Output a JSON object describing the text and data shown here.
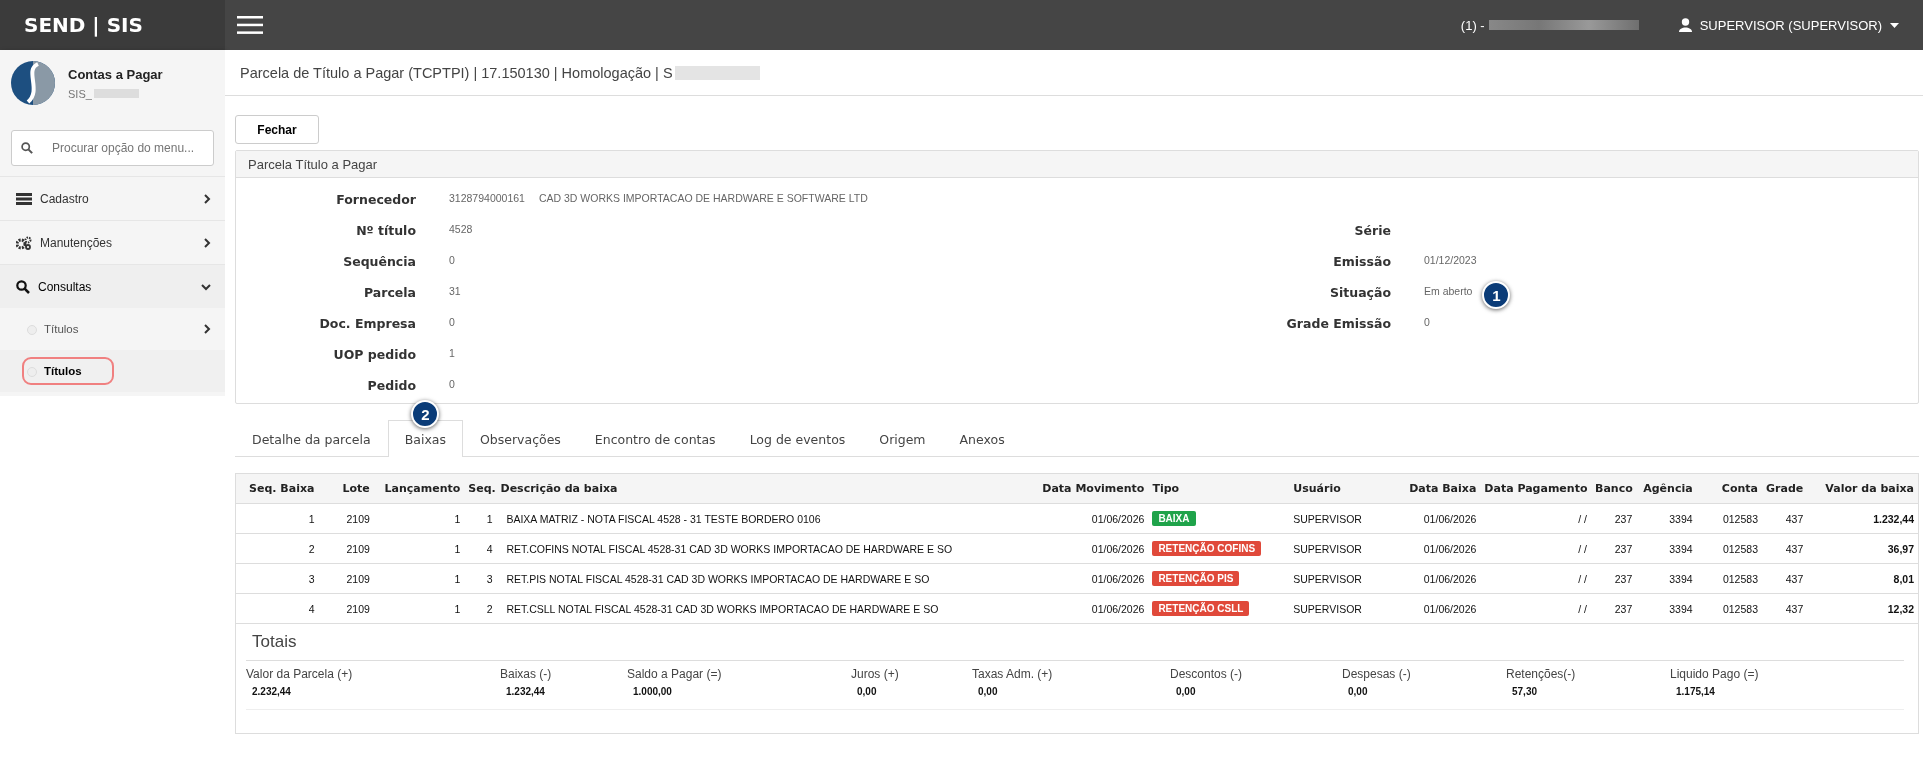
{
  "top_bar": {
    "logo": "SEND | SIS",
    "company": "(1) -",
    "user": "SUPERVISOR (SUPERVISOR)"
  },
  "sidebar": {
    "module": "Contas a Pagar",
    "subtitle": "SIS_",
    "search": {
      "placeholder": "Procurar opção do menu..."
    },
    "menu": [
      {
        "label": "Cadastro",
        "expanded": false
      },
      {
        "label": "Manutenções",
        "expanded": false
      },
      {
        "label": "Consultas",
        "expanded": true,
        "children": [
          {
            "label": "Títulos",
            "has_children": true,
            "selected": false
          },
          {
            "label": "Títulos",
            "has_children": false,
            "selected": true
          }
        ]
      }
    ]
  },
  "page_title": "Parcela de Título a Pagar (TCPTPI) | 17.150130 | Homologação | S",
  "buttons": [
    "Fechar"
  ],
  "panel": {
    "title": "Parcela Título a Pagar",
    "left_fields": [
      {
        "label": "Fornecedor",
        "values": [
          "3128794000161",
          "CAD 3D WORKS IMPORTACAO DE HARDWARE E SOFTWARE LTD"
        ]
      },
      {
        "label": "Nº título",
        "values": [
          "4528"
        ]
      },
      {
        "label": "Sequência",
        "values": [
          "0"
        ]
      },
      {
        "label": "Parcela",
        "values": [
          "31"
        ]
      },
      {
        "label": "Doc. Empresa",
        "values": [
          "0"
        ]
      },
      {
        "label": "UOP pedido",
        "values": [
          "1"
        ]
      },
      {
        "label": "Pedido",
        "values": [
          "0"
        ]
      }
    ],
    "right_fields": [
      {
        "label": "Série"
      },
      {
        "label": "Emissão",
        "values": [
          "01/12/2023"
        ]
      },
      {
        "label": "Situação",
        "values": [
          "Em aberto"
        ],
        "callout": "1"
      },
      {
        "label": "Grade Emissão",
        "values": [
          "0"
        ]
      }
    ]
  },
  "tabs": [
    {
      "label": "Detalhe da parcela",
      "selected": false
    },
    {
      "label": "Baixas",
      "selected": true,
      "callout": "2"
    },
    {
      "label": "Observações",
      "selected": false
    },
    {
      "label": "Encontro de contas",
      "selected": false
    },
    {
      "label": "Log de eventos",
      "selected": false
    },
    {
      "label": "Origem",
      "selected": false
    },
    {
      "label": "Anexos",
      "selected": false
    }
  ],
  "table": {
    "columns": [
      "Seq. Baixa",
      "Lote",
      "Lançamento",
      "Seq.",
      "Descrição da baixa",
      "Data Movimento",
      "Tipo",
      "Usuário",
      "Data Baixa",
      "Data Pagamento",
      "Banco",
      "Agência",
      "Conta",
      "Grade",
      "Valor da baixa"
    ],
    "rows": [
      {
        "cells": [
          "1",
          "2109",
          "1",
          "1",
          "BAIXA MATRIZ - NOTA FISCAL 4528 - 31 TESTE BORDERO 0106",
          "01/06/2026",
          "BAIXA",
          "SUPERVISOR",
          "01/06/2026",
          "/ /",
          "237",
          "3394",
          "012583",
          "437",
          "1.232,44"
        ],
        "color": "#1fa34a"
      },
      {
        "cells": [
          "2",
          "2109",
          "1",
          "4",
          "RET.COFINS NOTAL FISCAL 4528-31 CAD 3D WORKS IMPORTACAO DE HARDWARE E SO",
          "01/06/2026",
          "RETENÇÃO COFINS",
          "SUPERVISOR",
          "01/06/2026",
          "/ /",
          "237",
          "3394",
          "012583",
          "437",
          "36,97"
        ],
        "color": "#e0493a"
      },
      {
        "cells": [
          "3",
          "2109",
          "1",
          "3",
          "RET.PIS NOTAL FISCAL 4528-31 CAD 3D WORKS IMPORTACAO DE HARDWARE E SO",
          "01/06/2026",
          "RETENÇÃO PIS",
          "SUPERVISOR",
          "01/06/2026",
          "/ /",
          "237",
          "3394",
          "012583",
          "437",
          "8,01"
        ],
        "color": "#e0493a"
      },
      {
        "cells": [
          "4",
          "2109",
          "1",
          "2",
          "RET.CSLL NOTAL FISCAL 4528-31 CAD 3D WORKS IMPORTACAO DE HARDWARE E SO",
          "01/06/2026",
          "RETENÇÃO CSLL",
          "SUPERVISOR",
          "01/06/2026",
          "/ /",
          "237",
          "3394",
          "012583",
          "437",
          "12,32"
        ],
        "color": "#e0493a"
      }
    ]
  },
  "totals": {
    "title": "Totais",
    "items": [
      {
        "label": "Valor da Parcela (+)",
        "value": "2.232,44"
      },
      {
        "label": "Baixas (-)",
        "value": "1.232,44"
      },
      {
        "label": "Saldo a Pagar (=)",
        "value": "1.000,00"
      },
      {
        "label": "Juros (+)",
        "value": "0,00"
      },
      {
        "label": "Taxas Adm. (+)",
        "value": "0,00"
      },
      {
        "label": "Descontos (-)",
        "value": "0,00"
      },
      {
        "label": "Despesas (-)",
        "value": "0,00"
      },
      {
        "label": "Retenções(-)",
        "value": "57,30"
      },
      {
        "label": "Liquido Pago (=)",
        "value": "1.175,14"
      }
    ]
  }
}
